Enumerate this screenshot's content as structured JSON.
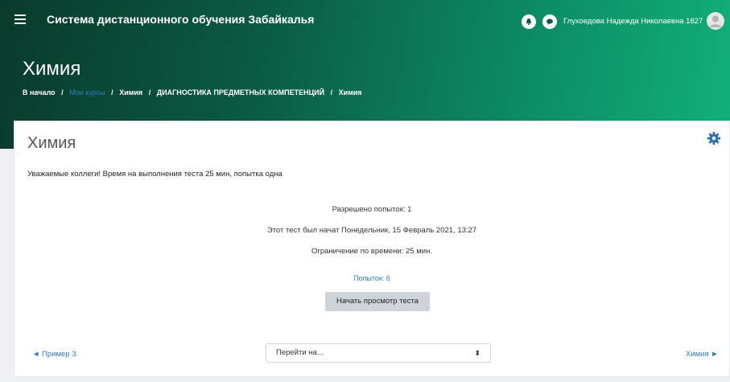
{
  "header": {
    "site_name": "Система дистанционного обучения Забайкалья",
    "user_name": "Глухоедова Надежда Николаевна 1827",
    "page_heading": "Химия"
  },
  "breadcrumb": {
    "items": [
      "В начало",
      "Мои курсы",
      "Химия",
      "ДИАГНОСТИКА ПРЕДМЕТНЫХ КОМПЕТЕНЦИЙ",
      "Химия"
    ],
    "separator": "/"
  },
  "quiz": {
    "title": "Химия",
    "intro": "Уважаемые коллеги! Время на выполнения теста 25 мин, попытка одна",
    "attempts_allowed": "Разрешено попыток: 1",
    "started_at": "Этот тест был начат Понедельник, 15 Февраль 2021, 13:27",
    "time_limit": "Ограничение по времени: 25 мин.",
    "attempts_link": "Попыток: 6",
    "start_button": "Начать просмотр теста"
  },
  "navigation": {
    "prev": "◄ Пример 3.",
    "jump_placeholder": "Перейти на...",
    "next": "Химия ►"
  },
  "colors": {
    "header_start": "#0a3a2c",
    "header_end": "#12b07a",
    "link": "#2d7bbd",
    "button_bg": "#ced4da"
  }
}
